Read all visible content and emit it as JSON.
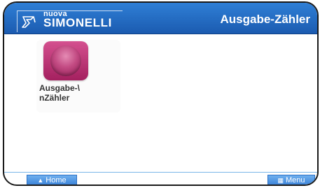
{
  "header": {
    "logo_small": "nuova",
    "logo_brand": "SIMONELLI",
    "title": "Ausgabe-Zähler"
  },
  "apps": [
    {
      "label": "Ausgabe-\\\nnZähler",
      "icon": "dispense-counter-icon"
    }
  ],
  "footer": {
    "home_label": "Home",
    "menu_label": "Menu"
  },
  "colors": {
    "header": "#1b5bb0",
    "accent": "#3a82d8",
    "app_icon": "#b8306f"
  }
}
